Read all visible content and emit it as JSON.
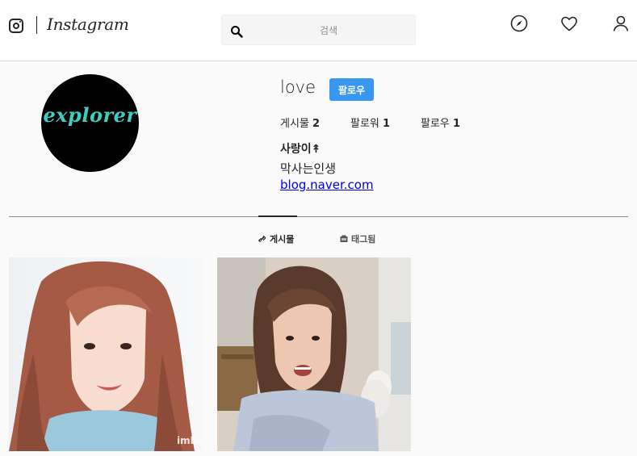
{
  "header": {
    "brand": "Instagram",
    "search": {
      "placeholder": "검색",
      "value": ""
    },
    "icons": [
      "explore-icon",
      "heart-icon",
      "profile-icon"
    ]
  },
  "profile": {
    "username": "love",
    "follow_label": "팔로우",
    "stats": {
      "posts_label": "게시물",
      "posts_count": "2",
      "followers_label": "팔로워",
      "followers_count": "1",
      "following_label": "팔로우",
      "following_count": "1"
    },
    "full_name": "사랑이↟",
    "bio": "막사는인생",
    "website": "blog.naver.com",
    "avatar_text": "explorer"
  },
  "tabs": [
    {
      "label": "게시물",
      "active": true,
      "icon": "grid-link-icon"
    },
    {
      "label": "태그됨",
      "active": false,
      "icon": "tag-icon"
    }
  ],
  "posts": [
    {
      "watermark": "imbc"
    },
    {
      "watermark": ""
    }
  ],
  "colors": {
    "accent": "#3897f0",
    "avatar_text": "#3ccfc0",
    "background": "#fafafa"
  }
}
